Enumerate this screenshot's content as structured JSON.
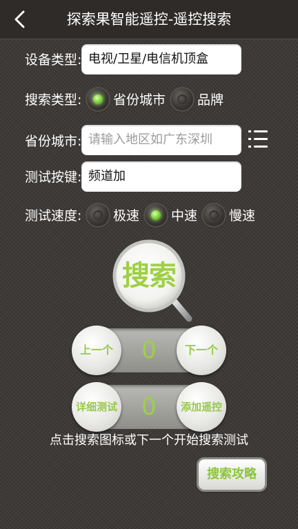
{
  "header": {
    "title": "探索果智能遥控-遥控搜索",
    "back_icon": "chevron-left-icon"
  },
  "form": {
    "device_type": {
      "label": "设备类型:",
      "value": "电视/卫星/电信机顶盒"
    },
    "search_type": {
      "label": "搜索类型:",
      "options": [
        {
          "label": "省份城市",
          "selected": true
        },
        {
          "label": "品牌",
          "selected": false
        }
      ]
    },
    "province_city": {
      "label": "省份城市:",
      "value": "",
      "placeholder": "请输入地区如广东深圳",
      "menu_icon": "list-icon"
    },
    "test_key": {
      "label": "测试按键:",
      "value": "频道加"
    },
    "test_speed": {
      "label": "测试速度:",
      "options": [
        {
          "label": "极速",
          "selected": false
        },
        {
          "label": "中速",
          "selected": true
        },
        {
          "label": "慢速",
          "selected": false
        }
      ]
    }
  },
  "search_button": {
    "label": "搜索",
    "icon": "magnifier-icon"
  },
  "controls": {
    "prev_label": "上一个",
    "next_label": "下一个",
    "counter_top": "0",
    "detail_test_label": "详细测试",
    "add_remote_label": "添加遥控",
    "counter_bottom": "0"
  },
  "hint": "点击搜索图标或下一个开始搜索测试",
  "strategy_button": {
    "label": "搜索攻略"
  },
  "colors": {
    "accent_green": "#9ed044",
    "background": "#3b3734"
  }
}
